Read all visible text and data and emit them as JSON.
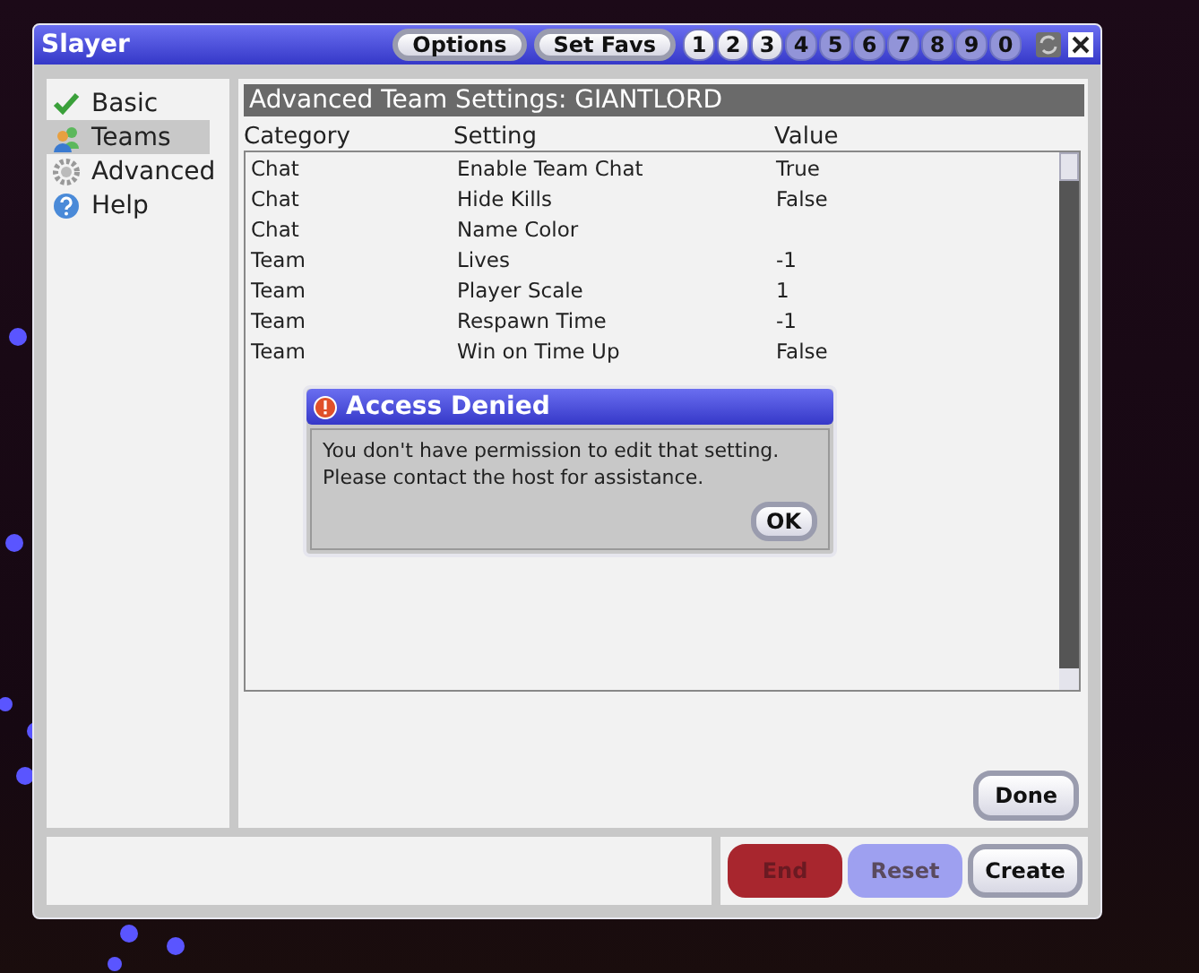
{
  "window": {
    "title": "Slayer"
  },
  "title_buttons": [
    {
      "label": "Options"
    },
    {
      "label": "Set Favs"
    }
  ],
  "favorites": [
    {
      "label": "1",
      "active": true
    },
    {
      "label": "2",
      "active": true
    },
    {
      "label": "3",
      "active": true
    },
    {
      "label": "4",
      "active": false
    },
    {
      "label": "5",
      "active": false
    },
    {
      "label": "6",
      "active": false
    },
    {
      "label": "7",
      "active": false
    },
    {
      "label": "8",
      "active": false
    },
    {
      "label": "9",
      "active": false
    },
    {
      "label": "0",
      "active": false
    }
  ],
  "sidebar": {
    "items": [
      {
        "label": "Basic",
        "kind": "check",
        "selected": false
      },
      {
        "label": "Teams",
        "kind": "people",
        "selected": true
      },
      {
        "label": "Advanced",
        "kind": "gear",
        "selected": false
      },
      {
        "label": "Help",
        "kind": "help",
        "selected": false
      }
    ]
  },
  "panel": {
    "title": "Advanced Team Settings: GIANTLORD"
  },
  "table": {
    "columns": [
      "Category",
      "Setting",
      "Value"
    ],
    "rows": [
      [
        "Chat",
        "Enable Team Chat",
        "True"
      ],
      [
        "Chat",
        "Hide Kills",
        "False"
      ],
      [
        "Chat",
        "Name Color",
        ""
      ],
      [
        "Team",
        "Lives",
        "-1"
      ],
      [
        "Team",
        "Player Scale",
        "1"
      ],
      [
        "Team",
        "Respawn Time",
        "-1"
      ],
      [
        "Team",
        "Win on Time Up",
        "False"
      ]
    ]
  },
  "dialog": {
    "title": "Access Denied",
    "message": [
      "You don't have permission to edit that setting.",
      "Please contact the host for assistance."
    ],
    "button": "OK"
  },
  "done_button": "Done",
  "footer_buttons": [
    {
      "label": "End",
      "kind": "danger",
      "disabled": true
    },
    {
      "label": "Reset",
      "kind": "accent",
      "disabled": true
    },
    {
      "label": "Create",
      "kind": "plain",
      "disabled": false
    }
  ]
}
